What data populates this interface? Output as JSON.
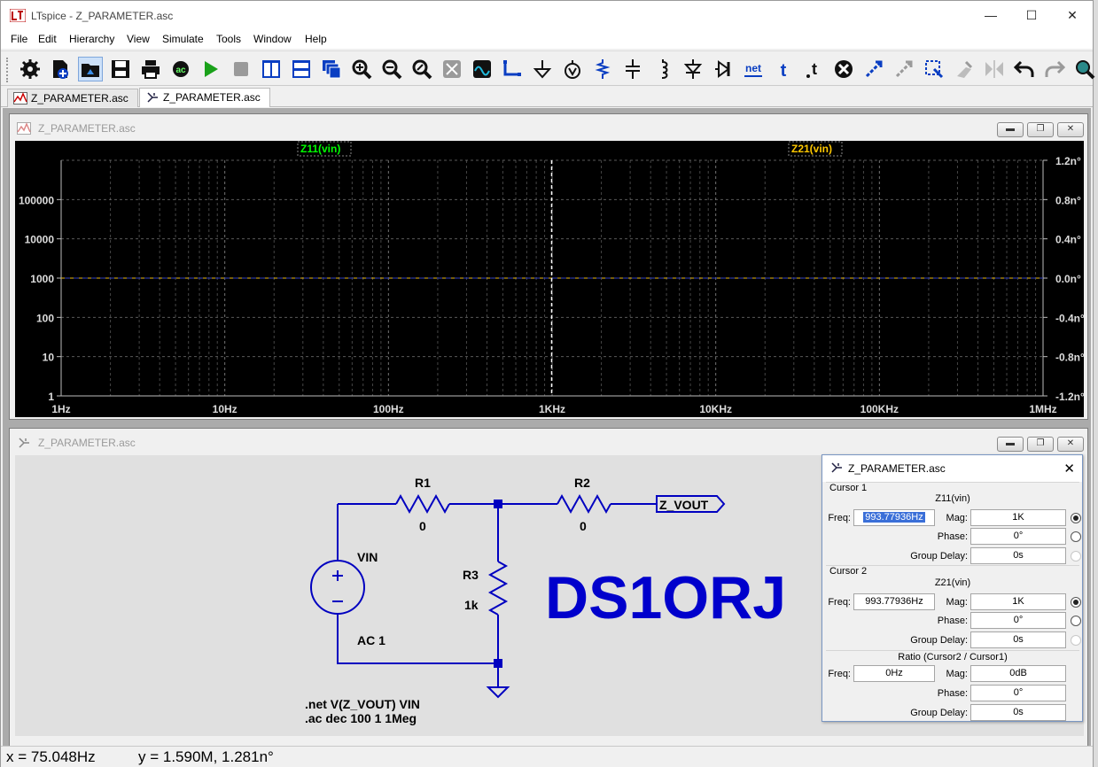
{
  "window": {
    "title": "LTspice - Z_PARAMETER.asc"
  },
  "menu": [
    "File",
    "Edit",
    "Hierarchy",
    "View",
    "Simulate",
    "Tools",
    "Window",
    "Help"
  ],
  "toolbar": [
    "settings-icon",
    "new-schematic-icon",
    "open-icon",
    "save-icon",
    "print-icon",
    "ac-analysis-icon",
    "run-icon",
    "halt-icon",
    "tile-vertical-icon",
    "tile-horizontal-icon",
    "cascade-icon",
    "zoom-in-icon",
    "zoom-out-icon",
    "zoom-fit-icon",
    "zoom-rect-icon",
    "waveform-icon",
    "draw-wire-icon",
    "ground-icon",
    "label-net-icon",
    "resistor-icon",
    "capacitor-icon",
    "inductor-icon",
    "diode-icon",
    "component-icon",
    "net-label-icon",
    "text-icon",
    "spice-directive-icon",
    "delete-icon",
    "duplicate-icon",
    "move-icon",
    "drag-icon",
    "rotate-icon",
    "mirror-icon",
    "undo-icon",
    "redo-icon",
    "find-icon"
  ],
  "tabs": [
    {
      "label": "Z_PARAMETER.asc",
      "kind": "plot"
    },
    {
      "label": "Z_PARAMETER.asc",
      "kind": "schematic"
    }
  ],
  "plot_window": {
    "title": "Z_PARAMETER.asc",
    "traces": [
      {
        "name": "Z11(vin)",
        "color": "#00ff00"
      },
      {
        "name": "Z21(vin)",
        "color": "#ffc800"
      }
    ]
  },
  "chart_data": {
    "type": "line",
    "x": [
      1,
      10,
      100,
      1000,
      10000,
      100000,
      1000000
    ],
    "xticklabels": [
      "1Hz",
      "10Hz",
      "100Hz",
      "1KHz",
      "10KHz",
      "100KHz",
      "1MHz"
    ],
    "xscale": "log",
    "xlim": [
      1,
      1000000
    ],
    "ylim_left": [
      1,
      1000000
    ],
    "yscale_left": "log",
    "yticklabels_left": [
      "1",
      "10",
      "100",
      "1000",
      "10000",
      "100000"
    ],
    "yticklabels_right": [
      "1.2n°",
      "0.8n°",
      "0.4n°",
      "0.0n°",
      "-0.4n°",
      "-0.8n°",
      "-1.2n°"
    ],
    "ylim_right": [
      -1.2,
      1.2
    ],
    "series": [
      {
        "name": "Z11(vin)",
        "values": [
          1000,
          1000,
          1000,
          1000,
          1000,
          1000,
          1000
        ]
      },
      {
        "name": "Z21(vin)",
        "values": [
          1000,
          1000,
          1000,
          1000,
          1000,
          1000,
          1000
        ]
      }
    ],
    "cursor_x": 993.77936,
    "grid": true
  },
  "schematic_window": {
    "title": "Z_PARAMETER.asc",
    "components": {
      "r1_name": "R1",
      "r1_value": "0",
      "r2_name": "R2",
      "r2_value": "0",
      "r3_name": "R3",
      "r3_value": "1k",
      "vin_name": "VIN",
      "vin_value": "AC 1",
      "net_label": "Z_VOUT"
    },
    "watermark": "DS1ORJ",
    "directives": [
      ".net  V(Z_VOUT) VIN",
      ".ac dec 100 1 1Meg"
    ]
  },
  "cursor_dialog": {
    "title": "Z_PARAMETER.asc",
    "cursor1": {
      "group": "Cursor 1",
      "trace": "Z11(vin)",
      "freq_label": "Freq:",
      "freq": "993.77936Hz",
      "mag_label": "Mag:",
      "mag": "1K",
      "phase_label": "Phase:",
      "phase": "0°",
      "gd_label": "Group Delay:",
      "gd": "0s"
    },
    "cursor2": {
      "group": "Cursor 2",
      "trace": "Z21(vin)",
      "freq_label": "Freq:",
      "freq": "993.77936Hz",
      "mag_label": "Mag:",
      "mag": "1K",
      "phase_label": "Phase:",
      "phase": "0°",
      "gd_label": "Group Delay:",
      "gd": "0s"
    },
    "ratio": {
      "label": "Ratio (Cursor2 / Cursor1)",
      "freq_label": "Freq:",
      "freq": "0Hz",
      "mag_label": "Mag:",
      "mag": "0dB",
      "phase_label": "Phase:",
      "phase": "0°",
      "gd_label": "Group Delay:",
      "gd": "0s"
    }
  },
  "status": {
    "x": "x = 75.048Hz",
    "y": "y = 1.590M, 1.281n°"
  },
  "colors": {
    "wire": "#0000c0",
    "watermark": "#0000cc",
    "plot_bg": "#000000",
    "grid": "#808080"
  }
}
